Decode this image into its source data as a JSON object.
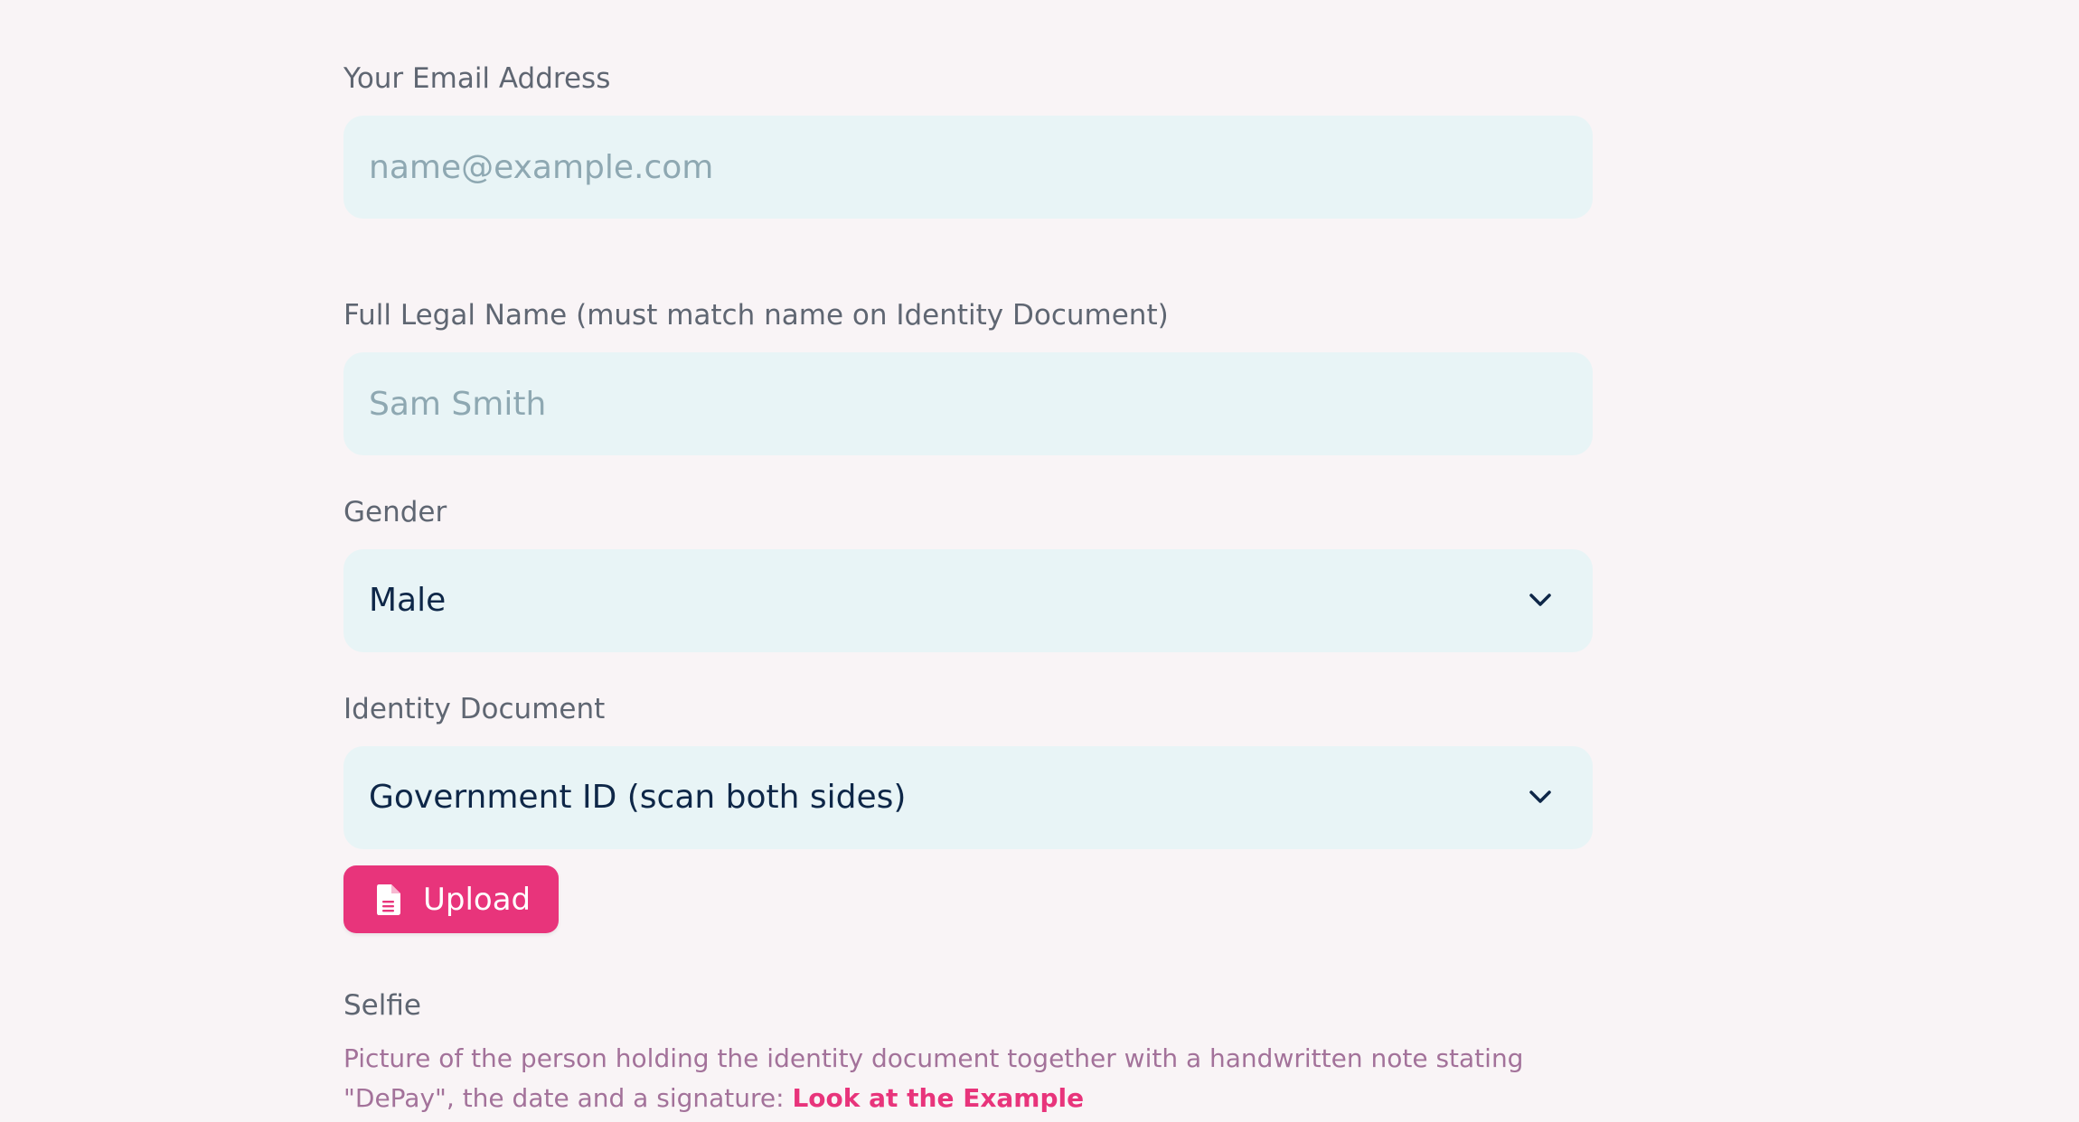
{
  "email": {
    "label": "Your Email Address",
    "placeholder": "name@example.com",
    "value": ""
  },
  "full_name": {
    "label": "Full Legal Name (must match name on Identity Document)",
    "placeholder": "Sam Smith",
    "value": ""
  },
  "gender": {
    "label": "Gender",
    "selected": "Male",
    "icon": "chevron-down-icon"
  },
  "identity_document": {
    "label": "Identity Document",
    "selected": "Government ID (scan both sides)",
    "icon": "chevron-down-icon"
  },
  "upload": {
    "label": "Upload",
    "icon": "file-icon"
  },
  "selfie": {
    "label": "Selfie",
    "description": "Picture of the person holding the identity document together with a handwritten note stating \"DePay\", the date and a signature: ",
    "example_link": "Look at the Example"
  },
  "colors": {
    "background": "#f9f4f6",
    "field": "#e8f4f6",
    "accent": "#e8347b",
    "label": "#5f6672",
    "text": "#0e2748",
    "placeholder": "#8ea8b2",
    "description": "#a3729a"
  }
}
